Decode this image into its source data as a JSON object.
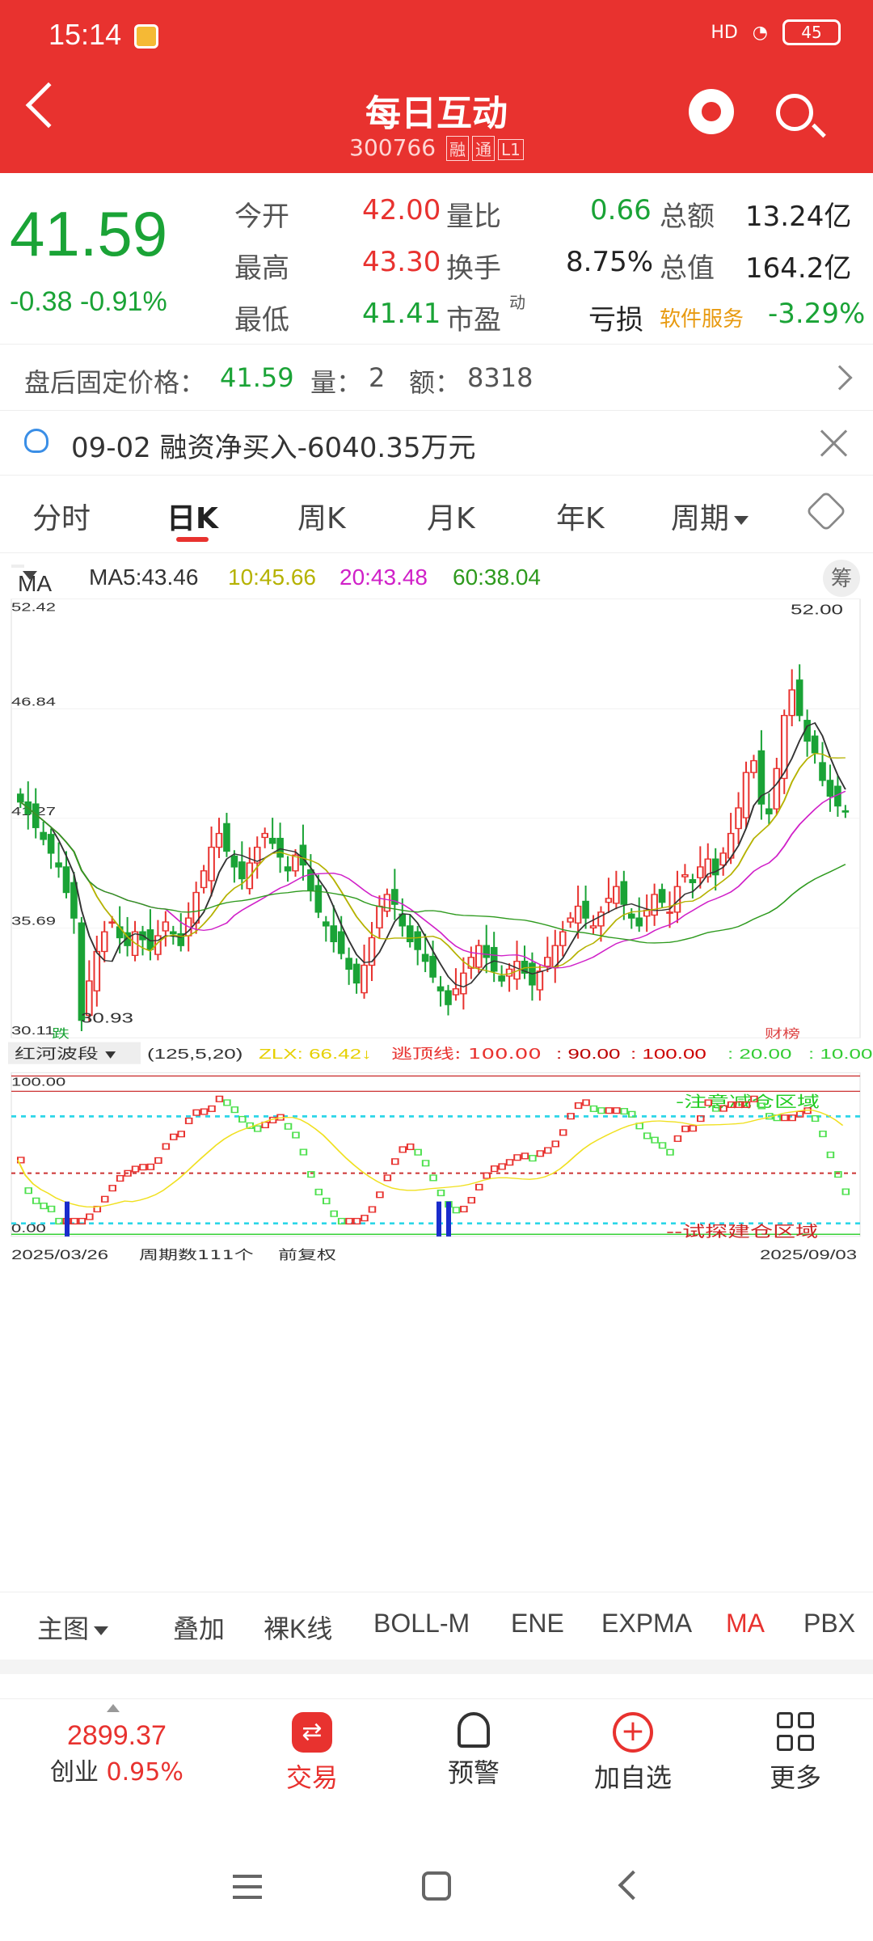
{
  "status": {
    "time": "15:14",
    "battery": "45",
    "signal": "HD"
  },
  "header": {
    "title": "每日互动",
    "code": "300766",
    "tags": [
      "融",
      "通",
      "L1"
    ]
  },
  "quote": {
    "price": "41.59",
    "change": "-0.38",
    "change_pct": "-0.91%",
    "rows": [
      {
        "l1": "今开",
        "v1": "42.00",
        "l2": "量比",
        "v2": "0.66",
        "l3": "总额",
        "v3": "13.24亿"
      },
      {
        "l1": "最高",
        "v1": "43.30",
        "l2": "换手",
        "v2": "8.75%",
        "l3": "总值",
        "v3": "164.2亿"
      },
      {
        "l1": "最低",
        "v1": "41.41",
        "l2": "市盈",
        "l2sup": "动",
        "v2": "亏损",
        "l3": "软件服务",
        "v3": "-3.29%"
      }
    ]
  },
  "after_hours": {
    "label": "盘后固定价格：",
    "price": "41.59",
    "vol_label": "量：",
    "vol": "2",
    "amt_label": "额：",
    "amt": "8318"
  },
  "notice": {
    "text": "09-02 融资净买入-6040.35万元"
  },
  "tabs": [
    "分时",
    "日K",
    "周K",
    "月K",
    "年K",
    "周期"
  ],
  "ma_legend": {
    "selector": "MA",
    "ma5": "MA5:43.46",
    "ma10": "10:45.66",
    "ma20": "20:43.48",
    "ma60": "60:38.04",
    "chou": "筹"
  },
  "colors": {
    "up": "#e8322f",
    "down": "#1aa336",
    "ma5": "#333333",
    "ma10": "#b5b200",
    "ma20": "#d020c8",
    "ma60": "#2e9a1e",
    "accent": "#e8322f"
  },
  "indicator": {
    "name": "红河波段",
    "params": "(125,5,20)",
    "zlx": "ZLX: 66.42",
    "escape_label": "逃顶线: 100.00",
    "v90": ": 90.00",
    "v100": ": 100.00",
    "v20": ": 20.00",
    "v10": ": 10.00",
    "top_zone": "-注意减仓区域",
    "bottom_zone": "--试探建仓区域",
    "y_top": "100.00",
    "y_bottom": "0.00"
  },
  "chart_footer": {
    "start": "2025/03/26",
    "periods": "周期数111个",
    "adjust": "前复权",
    "end": "2025/09/03"
  },
  "chart_data": {
    "type": "candlestick",
    "y_ticks": [
      "52.42",
      "46.84",
      "41.27",
      "35.69",
      "30.11"
    ],
    "ylim": [
      30.11,
      52.42
    ],
    "annotations": {
      "high": "52.00",
      "low": "30.93",
      "low_tag": "跌",
      "high_tag": "财榜"
    },
    "closes": [
      42.1,
      41.5,
      40.8,
      40.2,
      39.5,
      38.8,
      37.5,
      36.2,
      31.0,
      33.0,
      34.5,
      35.5,
      36.0,
      35.2,
      34.8,
      35.5,
      35.1,
      34.6,
      35.3,
      36.0,
      35.4,
      34.8,
      36.2,
      37.5,
      38.6,
      39.8,
      40.5,
      39.6,
      38.8,
      38.2,
      39.0,
      39.8,
      40.5,
      40.0,
      39.3,
      38.6,
      39.4,
      38.9,
      37.6,
      36.5,
      35.8,
      35.0,
      34.4,
      33.6,
      32.9,
      33.8,
      35.2,
      36.8,
      37.4,
      36.9,
      35.8,
      35.0,
      34.6,
      34.0,
      33.2,
      32.5,
      31.8,
      32.6,
      33.4,
      34.2,
      34.8,
      34.2,
      33.5,
      33.0,
      33.6,
      34.0,
      33.4,
      32.8,
      33.5,
      34.2,
      34.8,
      35.5,
      36.2,
      36.8,
      36.2,
      35.8,
      36.5,
      37.2,
      37.8,
      36.9,
      36.2,
      35.8,
      36.6,
      37.4,
      37.0,
      36.5,
      37.8,
      38.4,
      38.0,
      38.8,
      39.2,
      38.4,
      39.5,
      40.5,
      41.8,
      43.6,
      44.2,
      42.0,
      41.5,
      43.8,
      46.5,
      47.8,
      46.5,
      45.2,
      44.6,
      43.2,
      42.4,
      41.9,
      41.59
    ]
  },
  "indicator_tabs": [
    "主图",
    "叠加",
    "裸K线",
    "BOLL-M",
    "ENE",
    "EXPMA",
    "MA",
    "PBX"
  ],
  "bottom_nav": {
    "index_value": "2899.37",
    "index_name": "创业",
    "index_pct": "0.95%",
    "items": [
      "交易",
      "预警",
      "加自选",
      "更多"
    ]
  }
}
